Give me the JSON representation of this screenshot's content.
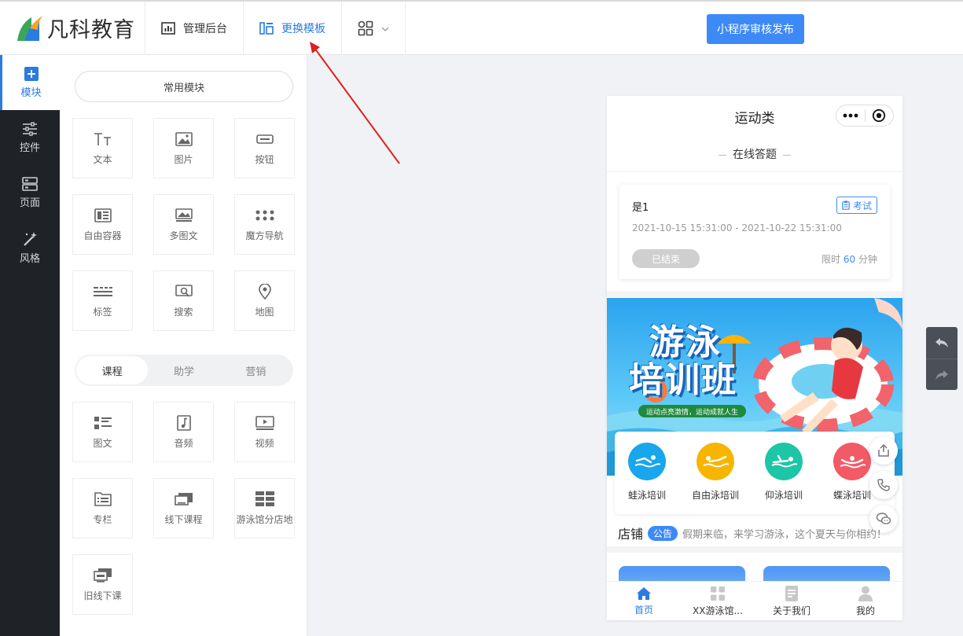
{
  "header": {
    "logo_text": "凡科教育",
    "nav": [
      {
        "label": "管理后台"
      },
      {
        "label": "更换模板"
      }
    ],
    "publish_label": "小程序审核发布"
  },
  "sidenav": [
    {
      "label": "模块"
    },
    {
      "label": "控件"
    },
    {
      "label": "页面"
    },
    {
      "label": "风格"
    }
  ],
  "panel": {
    "common_label": "常用模块",
    "common_modules": [
      "文本",
      "图片",
      "按钮",
      "自由容器",
      "多图文",
      "魔方导航",
      "标签",
      "搜索",
      "地图"
    ],
    "segments": [
      "课程",
      "助学",
      "营销"
    ],
    "course_modules": [
      "图文",
      "音频",
      "视频",
      "专栏",
      "线下课程",
      "游泳馆分店地",
      "旧线下课"
    ]
  },
  "phone": {
    "title": "运动类",
    "section_title": "在线答题",
    "quiz": {
      "name": "是1",
      "tag": "考试",
      "date_range": "2021-10-15 15:31:00 - 2021-10-22 15:31:00",
      "status": "已结束",
      "limit_prefix": "限时",
      "limit_value": "60",
      "limit_unit": "分钟"
    },
    "banner": {
      "line1": "游泳",
      "line2": "培训班",
      "slogan": "运动点亮激情，运动成就人生"
    },
    "categories": [
      {
        "label": "蛙泳培训",
        "color": "#18a6ec"
      },
      {
        "label": "自由泳培训",
        "color": "#f7b500"
      },
      {
        "label": "仰泳培训",
        "color": "#1cc6a6"
      },
      {
        "label": "蝶泳培训",
        "color": "#f25a66"
      }
    ],
    "notice": {
      "shop": "店铺",
      "badge": "公告",
      "text": "假期来临，来学习游泳，这个夏天与你相约！"
    },
    "tabs": [
      "首页",
      "XX游泳馆...",
      "关于我们",
      "我的"
    ]
  },
  "colors": {
    "accent": "#3d8af7",
    "annotation_arrow": "#e02020",
    "sidebar_bg": "#1f2227"
  }
}
